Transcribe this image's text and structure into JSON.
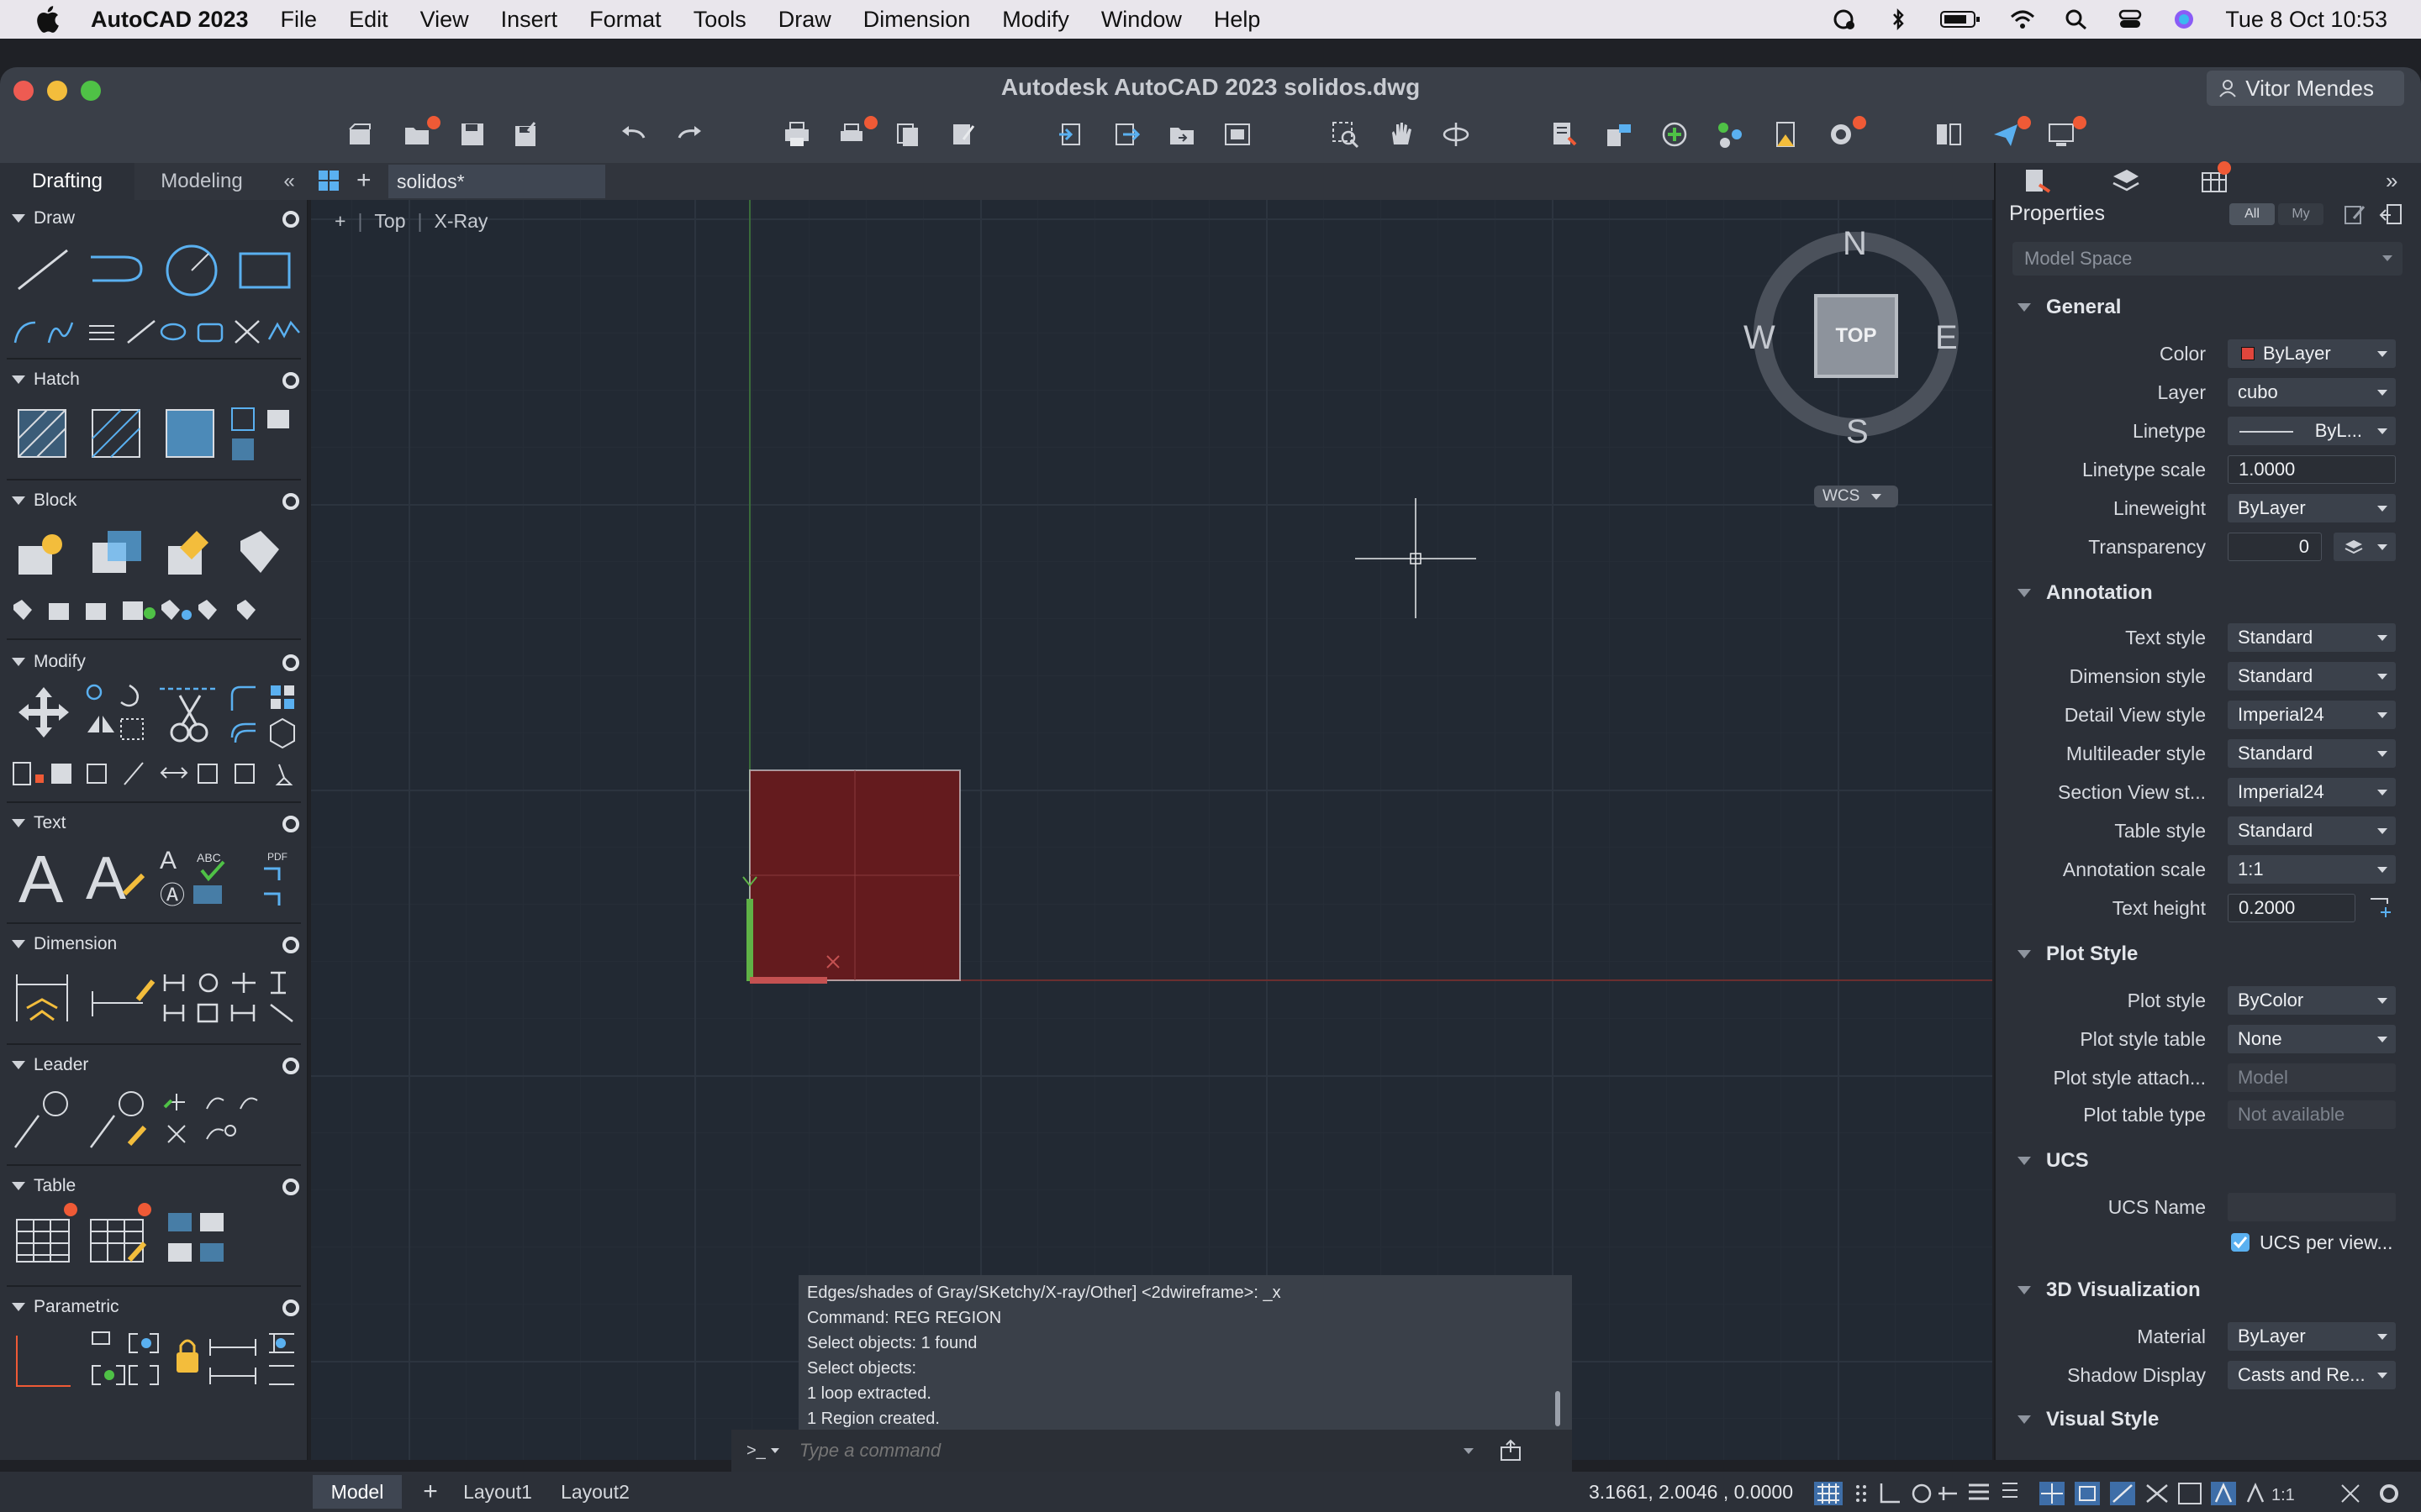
{
  "menubar": {
    "app_name": "AutoCAD 2023",
    "items": [
      "File",
      "Edit",
      "View",
      "Insert",
      "Format",
      "Tools",
      "Draw",
      "Dimension",
      "Modify",
      "Window",
      "Help"
    ],
    "datetime": "Tue 8 Oct  10:53"
  },
  "window": {
    "title": "Autodesk AutoCAD 2023    solidos.dwg",
    "user": "Vitor Mendes"
  },
  "palette_tabs": {
    "drafting": "Drafting",
    "modeling": "Modeling"
  },
  "document_tab": "solidos*",
  "sections": {
    "draw": "Draw",
    "hatch": "Hatch",
    "block": "Block",
    "modify": "Modify",
    "text": "Text",
    "dimension": "Dimension",
    "leader": "Leader",
    "table": "Table",
    "parametric": "Parametric"
  },
  "viewport": {
    "plus": "+",
    "view": "Top",
    "style": "X-Ray"
  },
  "viewcube": {
    "n": "N",
    "s": "S",
    "e": "E",
    "w": "W",
    "face": "TOP",
    "wcs": "WCS"
  },
  "command": {
    "history": [
      "Edges/shades of Gray/SKetchy/X-ray/Other] <2dwireframe>: _x",
      "Command: REG REGION",
      "Select objects: 1 found",
      "Select objects:",
      "1 loop extracted.",
      "1 Region created."
    ],
    "prompt_symbol": ">_",
    "placeholder": "Type a command"
  },
  "layout_tabs": [
    "Model",
    "Layout1",
    "Layout2"
  ],
  "status": {
    "coords": "3.1661,  2.0046 , 0.0000",
    "scale": "1:1"
  },
  "properties": {
    "title": "Properties",
    "filter_all": "All",
    "filter_my": "My",
    "selection": "Model Space",
    "categories": {
      "general": "General",
      "annotation": "Annotation",
      "plot_style": "Plot Style",
      "ucs": "UCS",
      "visualization": "3D Visualization",
      "visual_style": "Visual Style"
    },
    "general": [
      {
        "label": "Color",
        "value": "ByLayer"
      },
      {
        "label": "Layer",
        "value": "cubo"
      },
      {
        "label": "Linetype",
        "value": "ByL..."
      },
      {
        "label": "Linetype scale",
        "value": "1.0000"
      },
      {
        "label": "Lineweight",
        "value": "ByLayer"
      },
      {
        "label": "Transparency",
        "value": "0"
      }
    ],
    "annotation": [
      {
        "label": "Text style",
        "value": "Standard"
      },
      {
        "label": "Dimension style",
        "value": "Standard"
      },
      {
        "label": "Detail View style",
        "value": "Imperial24"
      },
      {
        "label": "Multileader style",
        "value": "Standard"
      },
      {
        "label": "Section View st...",
        "value": "Imperial24"
      },
      {
        "label": "Table style",
        "value": "Standard"
      },
      {
        "label": "Annotation scale",
        "value": "1:1"
      },
      {
        "label": "Text height",
        "value": "0.2000"
      }
    ],
    "plot_style": [
      {
        "label": "Plot style",
        "value": "ByColor"
      },
      {
        "label": "Plot style table",
        "value": "None"
      },
      {
        "label": "Plot style attach...",
        "value": "Model"
      },
      {
        "label": "Plot table type",
        "value": "Not available"
      }
    ],
    "ucs": [
      {
        "label": "UCS Name",
        "value": ""
      },
      {
        "label": "",
        "value": "UCS per view..."
      }
    ],
    "visualization": [
      {
        "label": "Material",
        "value": "ByLayer"
      },
      {
        "label": "Shadow Display",
        "value": "Casts and Re..."
      }
    ]
  },
  "colors": {
    "accent": "#ef5a36",
    "region_fill": "#641b1e",
    "color_swatch": "#e0463c"
  }
}
